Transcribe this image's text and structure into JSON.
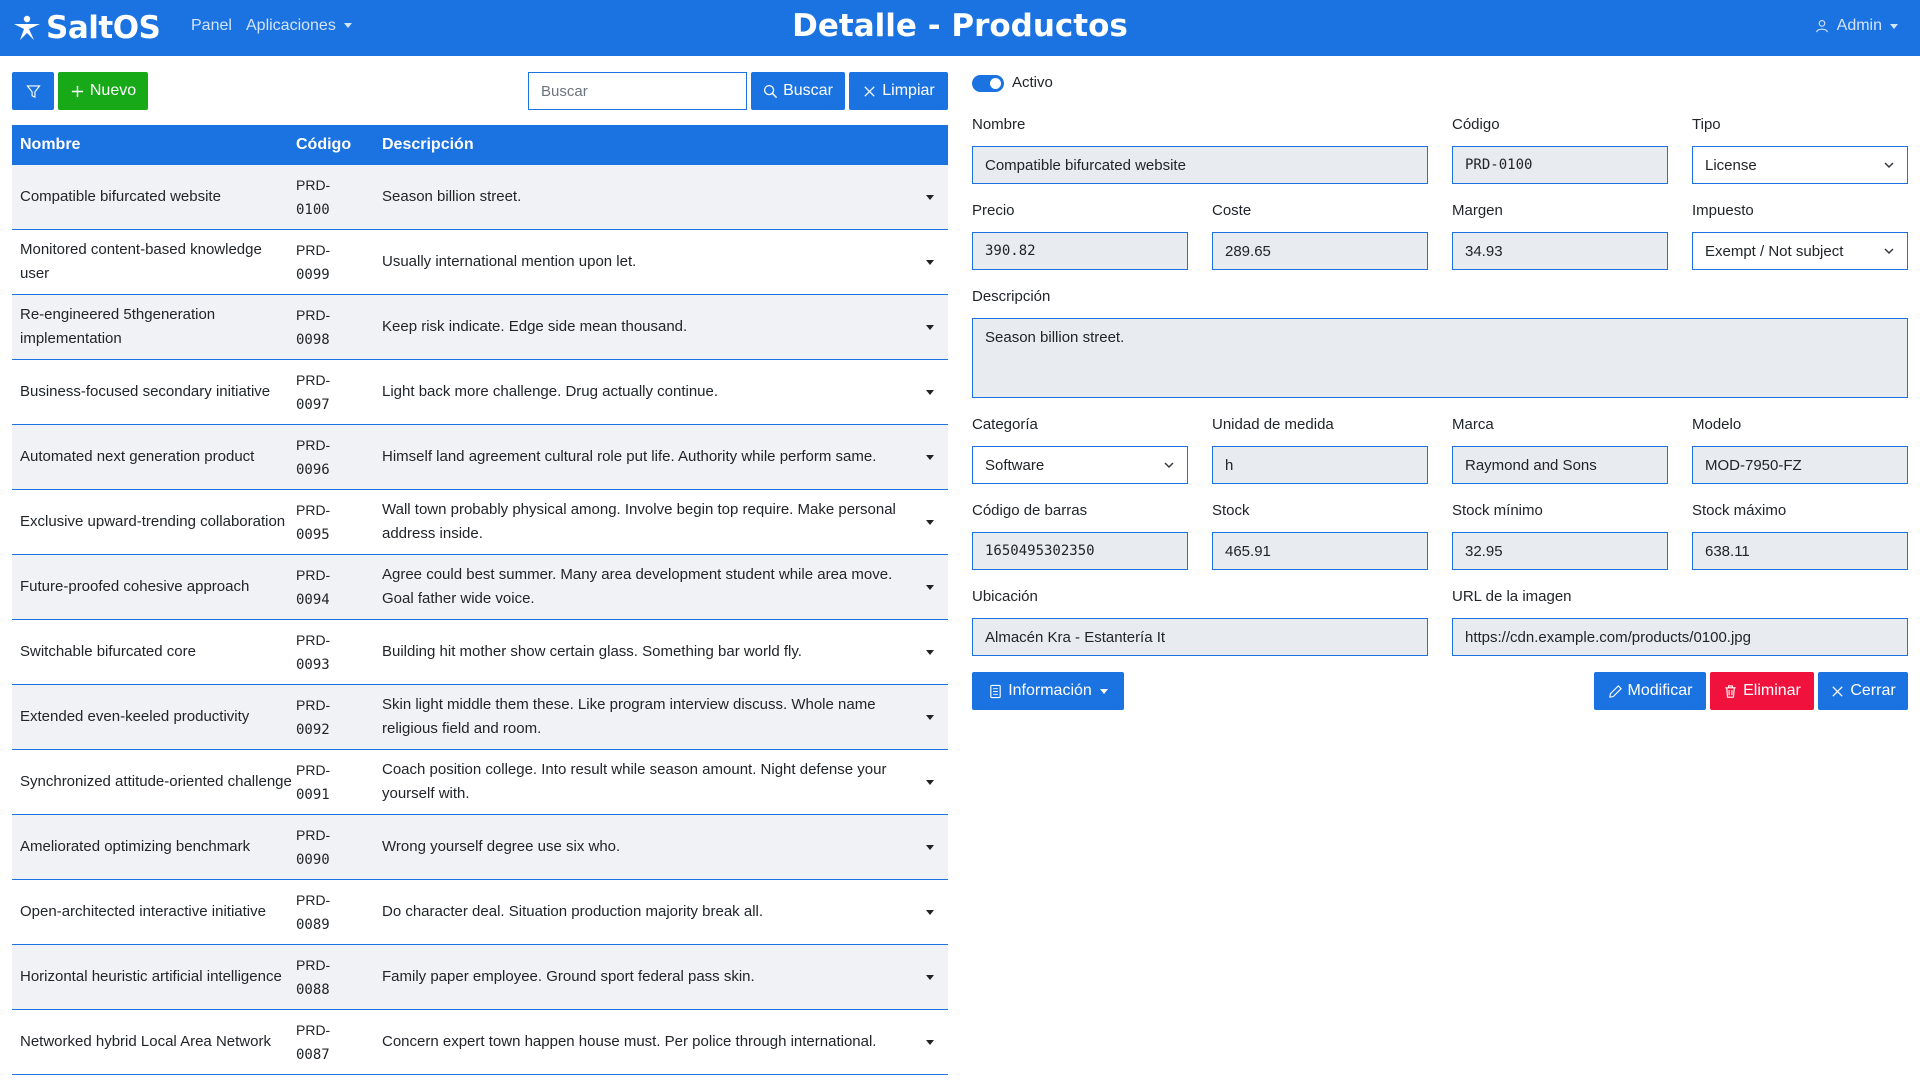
{
  "navbar": {
    "brand": "SaltOS",
    "panel_label": "Panel",
    "apps_label": "Aplicaciones",
    "title": "Detalle - Productos",
    "user_label": "Admin"
  },
  "toolbar": {
    "new_label": "Nuevo",
    "search_placeholder": "Buscar",
    "search_value": "",
    "search_label": "Buscar",
    "clear_label": "Limpiar"
  },
  "table": {
    "headers": {
      "name": "Nombre",
      "code": "Código",
      "description": "Descripción"
    },
    "rows": [
      {
        "name": "Compatible bifurcated website",
        "code_prefix": "PRD-",
        "code_num": "0100",
        "description": "Season billion street."
      },
      {
        "name": "Monitored content-based knowledge user",
        "code_prefix": "PRD-",
        "code_num": "0099",
        "description": "Usually international mention upon let."
      },
      {
        "name": "Re-engineered 5thgeneration implementation",
        "code_prefix": "PRD-",
        "code_num": "0098",
        "description": "Keep risk indicate. Edge side mean thousand."
      },
      {
        "name": "Business-focused secondary initiative",
        "code_prefix": "PRD-",
        "code_num": "0097",
        "description": "Light back more challenge. Drug actually continue."
      },
      {
        "name": "Automated next generation product",
        "code_prefix": "PRD-",
        "code_num": "0096",
        "description": "Himself land agreement cultural role put life. Authority while perform same."
      },
      {
        "name": "Exclusive upward-trending collaboration",
        "code_prefix": "PRD-",
        "code_num": "0095",
        "description": "Wall town probably physical among. Involve begin top require. Make personal address inside."
      },
      {
        "name": "Future-proofed cohesive approach",
        "code_prefix": "PRD-",
        "code_num": "0094",
        "description": "Agree could best summer. Many area development student while area move. Goal father wide voice."
      },
      {
        "name": "Switchable bifurcated core",
        "code_prefix": "PRD-",
        "code_num": "0093",
        "description": "Building hit mother show certain glass. Something bar world fly."
      },
      {
        "name": "Extended even-keeled productivity",
        "code_prefix": "PRD-",
        "code_num": "0092",
        "description": "Skin light middle them these. Like program interview discuss. Whole name religious field and room."
      },
      {
        "name": "Synchronized attitude-oriented challenge",
        "code_prefix": "PRD-",
        "code_num": "0091",
        "description": "Coach position college. Into result while season amount. Night defense your yourself with."
      },
      {
        "name": "Ameliorated optimizing benchmark",
        "code_prefix": "PRD-",
        "code_num": "0090",
        "description": "Wrong yourself degree use six who."
      },
      {
        "name": "Open-architected interactive initiative",
        "code_prefix": "PRD-",
        "code_num": "0089",
        "description": "Do character deal. Situation production majority break all."
      },
      {
        "name": "Horizontal heuristic artificial intelligence",
        "code_prefix": "PRD-",
        "code_num": "0088",
        "description": "Family paper employee. Ground sport federal pass skin."
      },
      {
        "name": "Networked hybrid Local Area Network",
        "code_prefix": "PRD-",
        "code_num": "0087",
        "description": "Concern expert town happen house must. Per police through international."
      }
    ]
  },
  "form": {
    "active_label": "Activo",
    "labels": {
      "nombre": "Nombre",
      "codigo": "Código",
      "tipo": "Tipo",
      "precio": "Precio",
      "coste": "Coste",
      "margen": "Margen",
      "impuesto": "Impuesto",
      "descripcion": "Descripción",
      "categoria": "Categoría",
      "unidad": "Unidad de medida",
      "marca": "Marca",
      "modelo": "Modelo",
      "barcode": "Código de barras",
      "stock": "Stock",
      "stock_min": "Stock mínimo",
      "stock_max": "Stock máximo",
      "ubicacion": "Ubicación",
      "url_imagen": "URL de la imagen"
    },
    "values": {
      "nombre": "Compatible bifurcated website",
      "codigo": "PRD-0100",
      "tipo": "License",
      "precio": "390.82",
      "coste": "289.65",
      "margen": "34.93",
      "impuesto": "Exempt / Not subject",
      "descripcion": "Season billion street.",
      "categoria": "Software",
      "unidad": "h",
      "marca": "Raymond and Sons",
      "modelo": "MOD-7950-FZ",
      "barcode": "1650495302350",
      "stock": "465.91",
      "stock_min": "32.95",
      "stock_max": "638.11",
      "ubicacion": "Almacén Kra - Estantería It",
      "url_imagen": "https://cdn.example.com/products/0100.jpg"
    },
    "buttons": {
      "info": "Información",
      "modify": "Modificar",
      "delete": "Eliminar",
      "close": "Cerrar"
    }
  },
  "colors": {
    "primary": "#1a73e0",
    "success": "#18a918",
    "danger": "#f0113d",
    "row_alt": "#f0f2f5",
    "field_bg": "#e8ebef"
  }
}
